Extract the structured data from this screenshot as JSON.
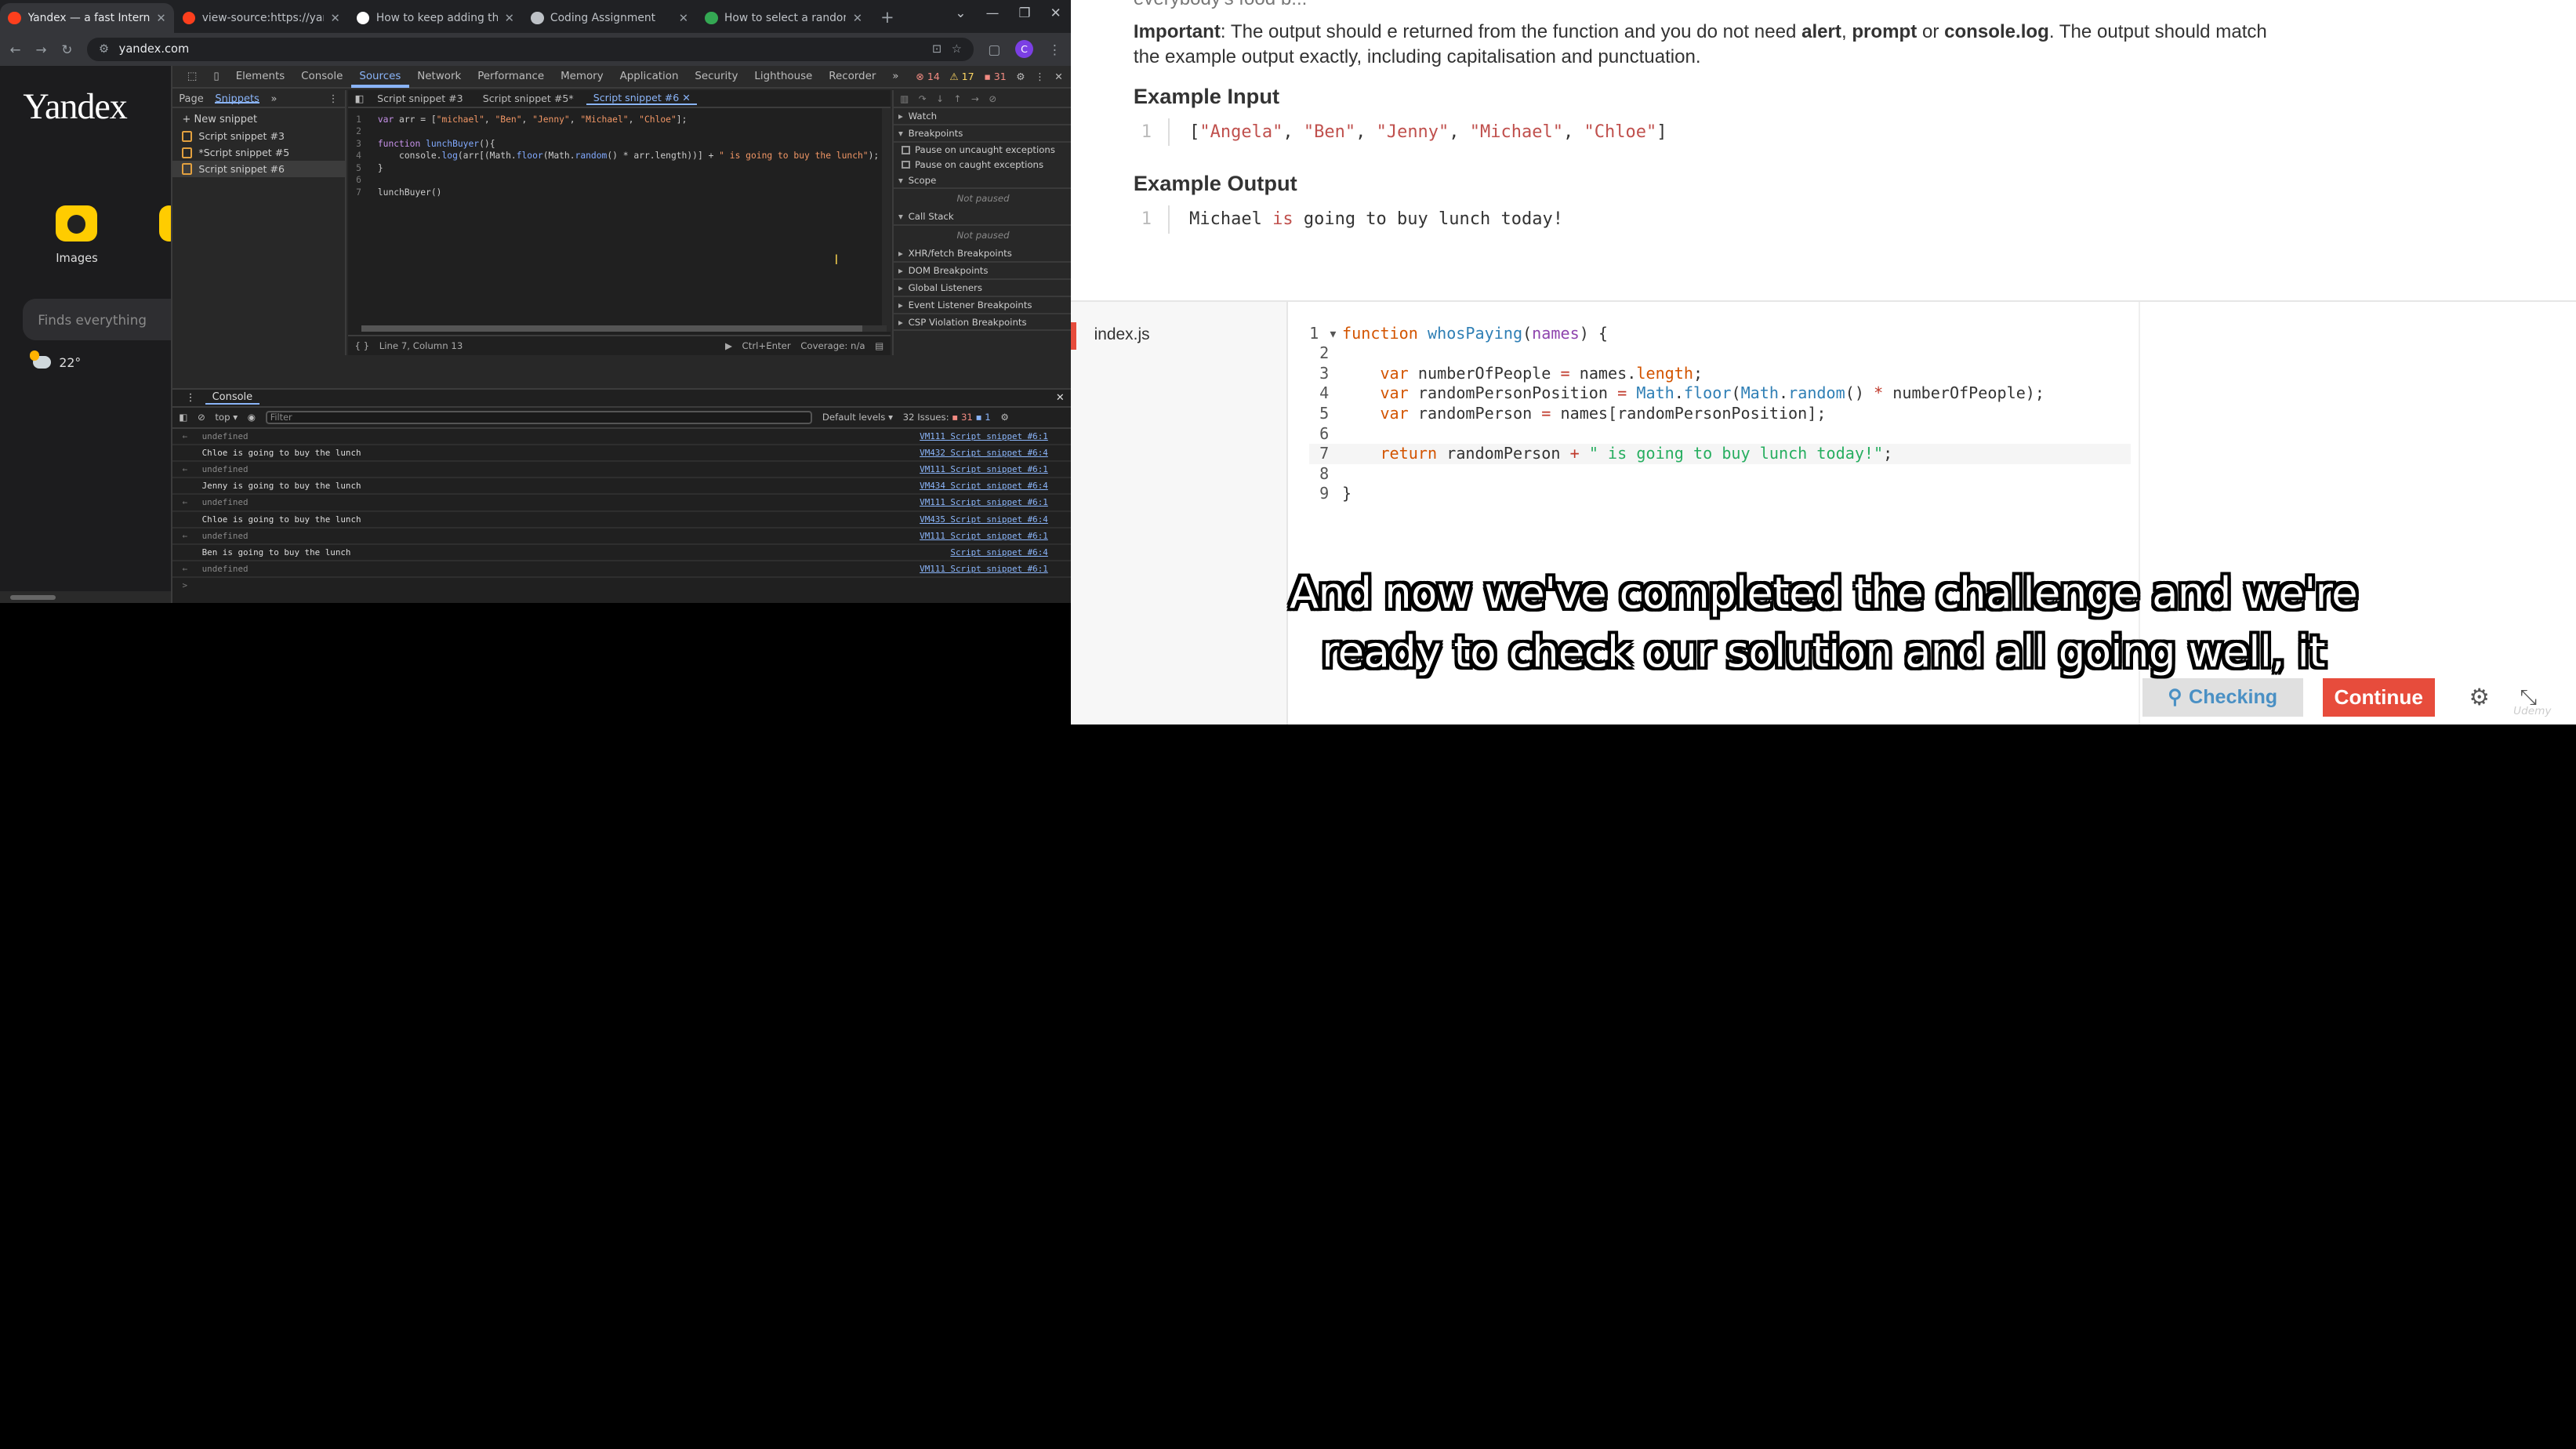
{
  "browser": {
    "tabs": [
      {
        "title": "Yandex — a fast Interne",
        "favicon_color": "#fc3f1d",
        "active": true
      },
      {
        "title": "view-source:https://yande",
        "favicon_color": "#fc3f1d",
        "active": false
      },
      {
        "title": "How to keep adding the te",
        "favicon_color": "#ffffff",
        "active": false
      },
      {
        "title": "Coding Assignment",
        "favicon_color": "#bdc1c6",
        "active": false
      },
      {
        "title": "How to select a random e",
        "favicon_color": "#34a853",
        "active": false
      }
    ],
    "url": "yandex.com",
    "profile_initial": "C"
  },
  "yandex": {
    "logo": "Yandex",
    "images_label": "Images",
    "search_placeholder": "Finds everything",
    "temperature": "22°"
  },
  "devtools": {
    "tabs": [
      "Elements",
      "Console",
      "Sources",
      "Network",
      "Performance",
      "Memory",
      "Application",
      "Security",
      "Lighthouse",
      "Recorder"
    ],
    "selected_tab": "Sources",
    "errors": "14",
    "warnings": "17",
    "info": "31",
    "navigator": {
      "tabs": [
        "Page",
        "Snippets"
      ],
      "new_snippet": "+ New snippet",
      "snippets": [
        "Script snippet #3",
        "*Script snippet #5",
        "Script snippet #6"
      ]
    },
    "editor": {
      "tabs": [
        "Script snippet #3",
        "Script snippet #5*",
        "Script snippet #6"
      ],
      "status_position": "Line 7, Column 13",
      "status_run": "Ctrl+Enter",
      "status_coverage": "Coverage: n/a"
    },
    "debugger": {
      "sections": [
        "Watch",
        "Breakpoints"
      ],
      "checks": [
        "Pause on uncaught exceptions",
        "Pause on caught exceptions"
      ],
      "scope": "Scope",
      "not_paused": "Not paused",
      "callstack": "Call Stack",
      "not_paused2": "Not paused",
      "more_sections": [
        "XHR/fetch Breakpoints",
        "DOM Breakpoints",
        "Global Listeners",
        "Event Listener Breakpoints",
        "CSP Violation Breakpoints"
      ]
    },
    "console": {
      "tab": "Console",
      "context": "top",
      "filter_placeholder": "Filter",
      "levels": "Default levels",
      "issues": "32 Issues:",
      "issues_err": "31",
      "issues_info": "1",
      "rows": [
        {
          "msg": "undefined",
          "src": "VM111 Script snippet #6:1",
          "kind": "u"
        },
        {
          "msg": "Chloe is going to buy the lunch",
          "src": "VM432 Script snippet #6:4",
          "kind": "l"
        },
        {
          "msg": "undefined",
          "src": "VM111 Script snippet #6:1",
          "kind": "u"
        },
        {
          "msg": "Jenny is going to buy the lunch",
          "src": "VM434 Script snippet #6:4",
          "kind": "l"
        },
        {
          "msg": "undefined",
          "src": "VM111 Script snippet #6:1",
          "kind": "u"
        },
        {
          "msg": "Chloe is going to buy the lunch",
          "src": "VM435 Script snippet #6:4",
          "kind": "l"
        },
        {
          "msg": "undefined",
          "src": "VM111 Script snippet #6:1",
          "kind": "u"
        },
        {
          "msg": "Ben is going to buy the lunch",
          "src": "Script snippet #6:4",
          "kind": "l"
        },
        {
          "msg": "undefined",
          "src": "VM111 Script snippet #6:1",
          "kind": "u"
        }
      ],
      "prompt": ">"
    }
  },
  "course": {
    "important_label": "Important",
    "important_text_1": ": The output should e returned from the function and you do not need ",
    "alert": "alert",
    "comma": ", ",
    "prompt": "prompt",
    "or": " or ",
    "console_log": "console.log",
    "important_text_2": ". The output should match",
    "important_line2": "the example output exactly, including capitalisation and punctuation.",
    "example_input_heading": "Example Input",
    "example_input_ln": "1",
    "example_output_heading": "Example Output",
    "example_output_ln": "1",
    "example_output_1": "Michael ",
    "example_output_is": "is",
    "example_output_2": " going to buy lunch today!",
    "top_cut_text": "everybody's food b..."
  },
  "ide": {
    "filename": "index.js",
    "accent": "#e74c3c"
  },
  "caption": {
    "line1": "And now we've completed the challenge and we're",
    "line2": "ready to check our solution and all going well, it"
  },
  "buttons": {
    "checking": "Checking",
    "continue": "Continue"
  },
  "watermark": "Udemy"
}
